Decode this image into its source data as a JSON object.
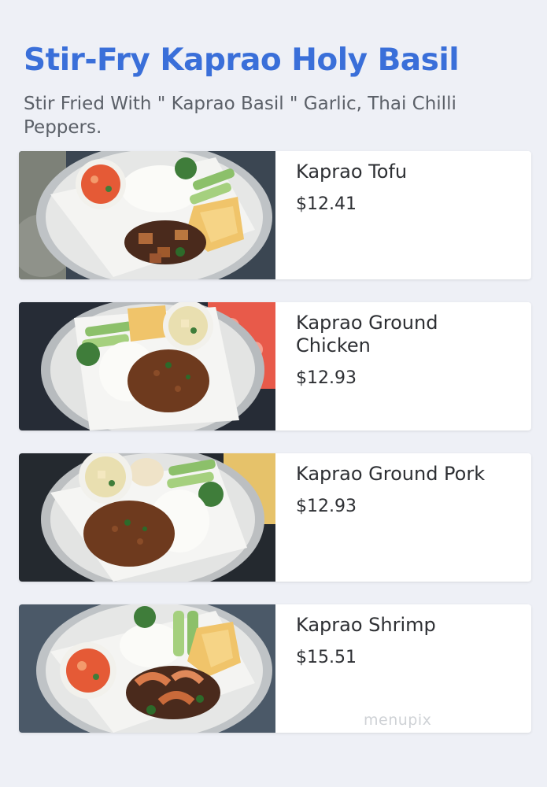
{
  "section": {
    "title": "Stir-Fry Kaprao Holy Basil",
    "description": "Stir Fried With \" Kaprao Basil \" Garlic, Thai Chilli Peppers."
  },
  "items": [
    {
      "name": "Kaprao Tofu",
      "price": "$12.41",
      "photo_icon": "food-photo-tofu"
    },
    {
      "name": "Kaprao Ground Chicken",
      "price": "$12.93",
      "photo_icon": "food-photo-ground-chicken"
    },
    {
      "name": "Kaprao Ground Pork",
      "price": "$12.93",
      "photo_icon": "food-photo-ground-pork"
    },
    {
      "name": "Kaprao Shrimp",
      "price": "$15.51",
      "photo_icon": "food-photo-shrimp"
    }
  ],
  "watermark": "menupix",
  "colors": {
    "background": "#eef0f6",
    "title": "#3a6fd9",
    "subtitle": "#5b6068",
    "item_text": "#2d2f33",
    "card": "#ffffff"
  }
}
